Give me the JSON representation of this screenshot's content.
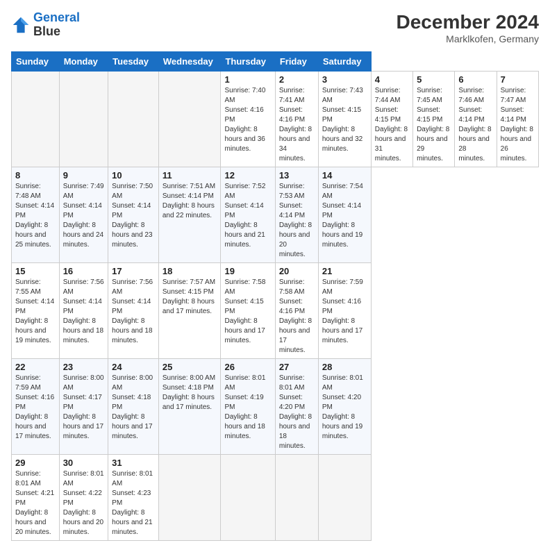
{
  "header": {
    "logo_line1": "General",
    "logo_line2": "Blue",
    "main_title": "December 2024",
    "subtitle": "Marklkofen, Germany"
  },
  "calendar": {
    "days_of_week": [
      "Sunday",
      "Monday",
      "Tuesday",
      "Wednesday",
      "Thursday",
      "Friday",
      "Saturday"
    ],
    "weeks": [
      [
        null,
        null,
        null,
        null,
        {
          "day": "1",
          "sunrise": "7:40 AM",
          "sunset": "4:16 PM",
          "daylight": "8 hours and 36 minutes."
        },
        {
          "day": "2",
          "sunrise": "7:41 AM",
          "sunset": "4:16 PM",
          "daylight": "8 hours and 34 minutes."
        },
        {
          "day": "3",
          "sunrise": "7:43 AM",
          "sunset": "4:15 PM",
          "daylight": "8 hours and 32 minutes."
        },
        {
          "day": "4",
          "sunrise": "7:44 AM",
          "sunset": "4:15 PM",
          "daylight": "8 hours and 31 minutes."
        },
        {
          "day": "5",
          "sunrise": "7:45 AM",
          "sunset": "4:15 PM",
          "daylight": "8 hours and 29 minutes."
        },
        {
          "day": "6",
          "sunrise": "7:46 AM",
          "sunset": "4:14 PM",
          "daylight": "8 hours and 28 minutes."
        },
        {
          "day": "7",
          "sunrise": "7:47 AM",
          "sunset": "4:14 PM",
          "daylight": "8 hours and 26 minutes."
        }
      ],
      [
        {
          "day": "8",
          "sunrise": "7:48 AM",
          "sunset": "4:14 PM",
          "daylight": "8 hours and 25 minutes."
        },
        {
          "day": "9",
          "sunrise": "7:49 AM",
          "sunset": "4:14 PM",
          "daylight": "8 hours and 24 minutes."
        },
        {
          "day": "10",
          "sunrise": "7:50 AM",
          "sunset": "4:14 PM",
          "daylight": "8 hours and 23 minutes."
        },
        {
          "day": "11",
          "sunrise": "7:51 AM",
          "sunset": "4:14 PM",
          "daylight": "8 hours and 22 minutes."
        },
        {
          "day": "12",
          "sunrise": "7:52 AM",
          "sunset": "4:14 PM",
          "daylight": "8 hours and 21 minutes."
        },
        {
          "day": "13",
          "sunrise": "7:53 AM",
          "sunset": "4:14 PM",
          "daylight": "8 hours and 20 minutes."
        },
        {
          "day": "14",
          "sunrise": "7:54 AM",
          "sunset": "4:14 PM",
          "daylight": "8 hours and 19 minutes."
        }
      ],
      [
        {
          "day": "15",
          "sunrise": "7:55 AM",
          "sunset": "4:14 PM",
          "daylight": "8 hours and 19 minutes."
        },
        {
          "day": "16",
          "sunrise": "7:56 AM",
          "sunset": "4:14 PM",
          "daylight": "8 hours and 18 minutes."
        },
        {
          "day": "17",
          "sunrise": "7:56 AM",
          "sunset": "4:14 PM",
          "daylight": "8 hours and 18 minutes."
        },
        {
          "day": "18",
          "sunrise": "7:57 AM",
          "sunset": "4:15 PM",
          "daylight": "8 hours and 17 minutes."
        },
        {
          "day": "19",
          "sunrise": "7:58 AM",
          "sunset": "4:15 PM",
          "daylight": "8 hours and 17 minutes."
        },
        {
          "day": "20",
          "sunrise": "7:58 AM",
          "sunset": "4:16 PM",
          "daylight": "8 hours and 17 minutes."
        },
        {
          "day": "21",
          "sunrise": "7:59 AM",
          "sunset": "4:16 PM",
          "daylight": "8 hours and 17 minutes."
        }
      ],
      [
        {
          "day": "22",
          "sunrise": "7:59 AM",
          "sunset": "4:16 PM",
          "daylight": "8 hours and 17 minutes."
        },
        {
          "day": "23",
          "sunrise": "8:00 AM",
          "sunset": "4:17 PM",
          "daylight": "8 hours and 17 minutes."
        },
        {
          "day": "24",
          "sunrise": "8:00 AM",
          "sunset": "4:18 PM",
          "daylight": "8 hours and 17 minutes."
        },
        {
          "day": "25",
          "sunrise": "8:00 AM",
          "sunset": "4:18 PM",
          "daylight": "8 hours and 17 minutes."
        },
        {
          "day": "26",
          "sunrise": "8:01 AM",
          "sunset": "4:19 PM",
          "daylight": "8 hours and 18 minutes."
        },
        {
          "day": "27",
          "sunrise": "8:01 AM",
          "sunset": "4:20 PM",
          "daylight": "8 hours and 18 minutes."
        },
        {
          "day": "28",
          "sunrise": "8:01 AM",
          "sunset": "4:20 PM",
          "daylight": "8 hours and 19 minutes."
        }
      ],
      [
        {
          "day": "29",
          "sunrise": "8:01 AM",
          "sunset": "4:21 PM",
          "daylight": "8 hours and 20 minutes."
        },
        {
          "day": "30",
          "sunrise": "8:01 AM",
          "sunset": "4:22 PM",
          "daylight": "8 hours and 20 minutes."
        },
        {
          "day": "31",
          "sunrise": "8:01 AM",
          "sunset": "4:23 PM",
          "daylight": "8 hours and 21 minutes."
        },
        null,
        null,
        null,
        null
      ]
    ]
  }
}
